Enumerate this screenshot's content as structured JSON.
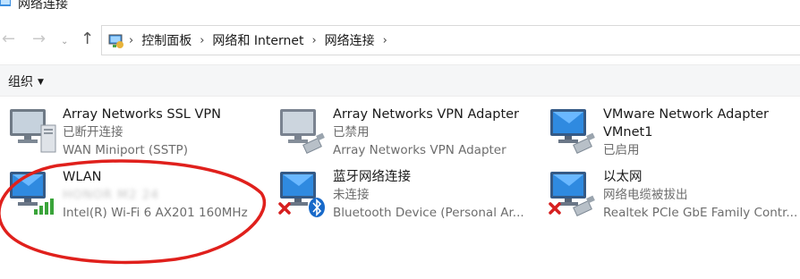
{
  "window": {
    "title": "网络连接"
  },
  "nav": {
    "back": "←",
    "forward": "→",
    "recent": "⌄",
    "up": "↑",
    "breadcrumb": [
      "控制面板",
      "网络和 Internet",
      "网络连接"
    ]
  },
  "toolbar": {
    "organize_label": "组织"
  },
  "connections": [
    {
      "name": "Array Networks SSL VPN",
      "status": "已断开连接",
      "device": "WAN Miniport (SSTP)",
      "icon": "network-adapter-icon"
    },
    {
      "name": "Array Networks VPN Adapter",
      "status": "已禁用",
      "device": "Array Networks VPN Adapter",
      "icon": "network-adapter-disabled-icon"
    },
    {
      "name": "VMware Network Adapter",
      "name_line2": "VMnet1",
      "status": "已启用",
      "device": "",
      "icon": "network-adapter-icon"
    },
    {
      "name": "WLAN",
      "status": "HONOR M2 24",
      "device": "Intel(R) Wi-Fi 6 AX201 160MHz",
      "icon": "wifi-adapter-icon"
    },
    {
      "name": "蓝牙网络连接",
      "status": "未连接",
      "device": "Bluetooth Device (Personal Ar...",
      "icon": "bluetooth-adapter-icon"
    },
    {
      "name": "以太网",
      "status": "网络电缆被拔出",
      "device": "Realtek PCIe GbE Family Contr...",
      "icon": "ethernet-adapter-icon"
    }
  ],
  "colors": {
    "annotation": "#e0201c",
    "monitor_blue": "#2a7fd4",
    "status_gray": "#6d6d6d"
  }
}
